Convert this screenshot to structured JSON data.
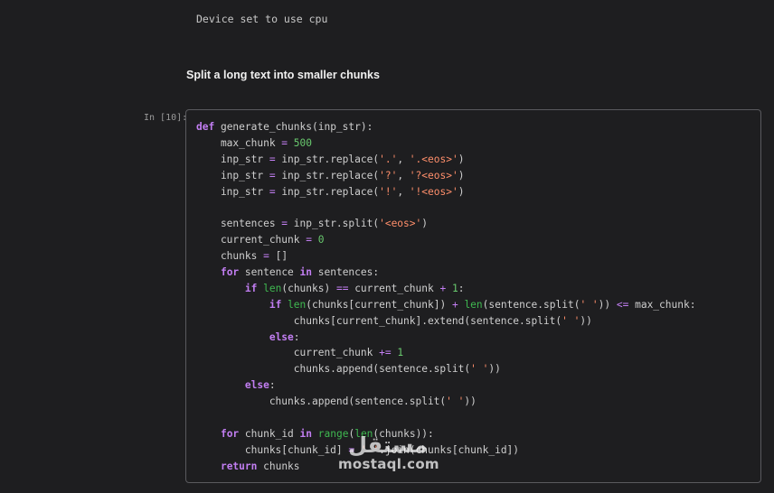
{
  "output": {
    "text": "Device set to use cpu"
  },
  "markdown": {
    "heading": "Split a long text into smaller chunks"
  },
  "cell": {
    "prompt": "In [10]:",
    "lines": [
      [
        [
          "kw",
          "def"
        ],
        [
          "p",
          " generate_chunks(inp_str):"
        ]
      ],
      [
        [
          "p",
          "    max_chunk "
        ],
        [
          "op",
          "="
        ],
        [
          "p",
          " "
        ],
        [
          "num",
          "500"
        ]
      ],
      [
        [
          "p",
          "    inp_str "
        ],
        [
          "op",
          "="
        ],
        [
          "p",
          " inp_str.replace("
        ],
        [
          "str",
          "'.'"
        ],
        [
          "p",
          ", "
        ],
        [
          "str",
          "'.<eos>'"
        ],
        [
          "p",
          ")"
        ]
      ],
      [
        [
          "p",
          "    inp_str "
        ],
        [
          "op",
          "="
        ],
        [
          "p",
          " inp_str.replace("
        ],
        [
          "str",
          "'?'"
        ],
        [
          "p",
          ", "
        ],
        [
          "str",
          "'?<eos>'"
        ],
        [
          "p",
          ")"
        ]
      ],
      [
        [
          "p",
          "    inp_str "
        ],
        [
          "op",
          "="
        ],
        [
          "p",
          " inp_str.replace("
        ],
        [
          "str",
          "'!'"
        ],
        [
          "p",
          ", "
        ],
        [
          "str",
          "'!<eos>'"
        ],
        [
          "p",
          ")"
        ]
      ],
      [],
      [
        [
          "p",
          "    sentences "
        ],
        [
          "op",
          "="
        ],
        [
          "p",
          " inp_str.split("
        ],
        [
          "str",
          "'<eos>'"
        ],
        [
          "p",
          ")"
        ]
      ],
      [
        [
          "p",
          "    current_chunk "
        ],
        [
          "op",
          "="
        ],
        [
          "p",
          " "
        ],
        [
          "num",
          "0"
        ]
      ],
      [
        [
          "p",
          "    chunks "
        ],
        [
          "op",
          "="
        ],
        [
          "p",
          " []"
        ]
      ],
      [
        [
          "p",
          "    "
        ],
        [
          "kw",
          "for"
        ],
        [
          "p",
          " sentence "
        ],
        [
          "kw",
          "in"
        ],
        [
          "p",
          " sentences:"
        ]
      ],
      [
        [
          "p",
          "        "
        ],
        [
          "kw",
          "if"
        ],
        [
          "p",
          " "
        ],
        [
          "bi",
          "len"
        ],
        [
          "p",
          "(chunks) "
        ],
        [
          "op",
          "=="
        ],
        [
          "p",
          " current_chunk "
        ],
        [
          "op",
          "+"
        ],
        [
          "p",
          " "
        ],
        [
          "num",
          "1"
        ],
        [
          "p",
          ":"
        ]
      ],
      [
        [
          "p",
          "            "
        ],
        [
          "kw",
          "if"
        ],
        [
          "p",
          " "
        ],
        [
          "bi",
          "len"
        ],
        [
          "p",
          "(chunks[current_chunk]) "
        ],
        [
          "op",
          "+"
        ],
        [
          "p",
          " "
        ],
        [
          "bi",
          "len"
        ],
        [
          "p",
          "(sentence.split("
        ],
        [
          "str",
          "' '"
        ],
        [
          "p",
          ")) "
        ],
        [
          "op",
          "<="
        ],
        [
          "p",
          " max_chunk:"
        ]
      ],
      [
        [
          "p",
          "                chunks[current_chunk].extend(sentence.split("
        ],
        [
          "str",
          "' '"
        ],
        [
          "p",
          "))"
        ]
      ],
      [
        [
          "p",
          "            "
        ],
        [
          "kw",
          "else"
        ],
        [
          "p",
          ":"
        ]
      ],
      [
        [
          "p",
          "                current_chunk "
        ],
        [
          "op",
          "+="
        ],
        [
          "p",
          " "
        ],
        [
          "num",
          "1"
        ]
      ],
      [
        [
          "p",
          "                chunks.append(sentence.split("
        ],
        [
          "str",
          "' '"
        ],
        [
          "p",
          "))"
        ]
      ],
      [
        [
          "p",
          "        "
        ],
        [
          "kw",
          "else"
        ],
        [
          "p",
          ":"
        ]
      ],
      [
        [
          "p",
          "            chunks.append(sentence.split("
        ],
        [
          "str",
          "' '"
        ],
        [
          "p",
          "))"
        ]
      ],
      [],
      [
        [
          "p",
          "    "
        ],
        [
          "kw",
          "for"
        ],
        [
          "p",
          " chunk_id "
        ],
        [
          "kw",
          "in"
        ],
        [
          "p",
          " "
        ],
        [
          "bi",
          "range"
        ],
        [
          "p",
          "("
        ],
        [
          "bi",
          "len"
        ],
        [
          "p",
          "(chunks)):"
        ]
      ],
      [
        [
          "p",
          "        chunks[chunk_id] "
        ],
        [
          "op",
          "="
        ],
        [
          "p",
          " "
        ],
        [
          "str",
          "' '"
        ],
        [
          "p",
          ".join(chunks[chunk_id])"
        ]
      ],
      [
        [
          "p",
          "    "
        ],
        [
          "kw",
          "return"
        ],
        [
          "p",
          " chunks"
        ]
      ]
    ]
  },
  "watermark": {
    "arabic": "مستقل",
    "latin": "mostaql.com"
  },
  "colors": {
    "background": "#1e1e20",
    "keyword": "#c27ef2",
    "builtin": "#3fb950",
    "number": "#69c96e",
    "string": "#ff8f6b",
    "cell_border": "#5a5a5e"
  }
}
